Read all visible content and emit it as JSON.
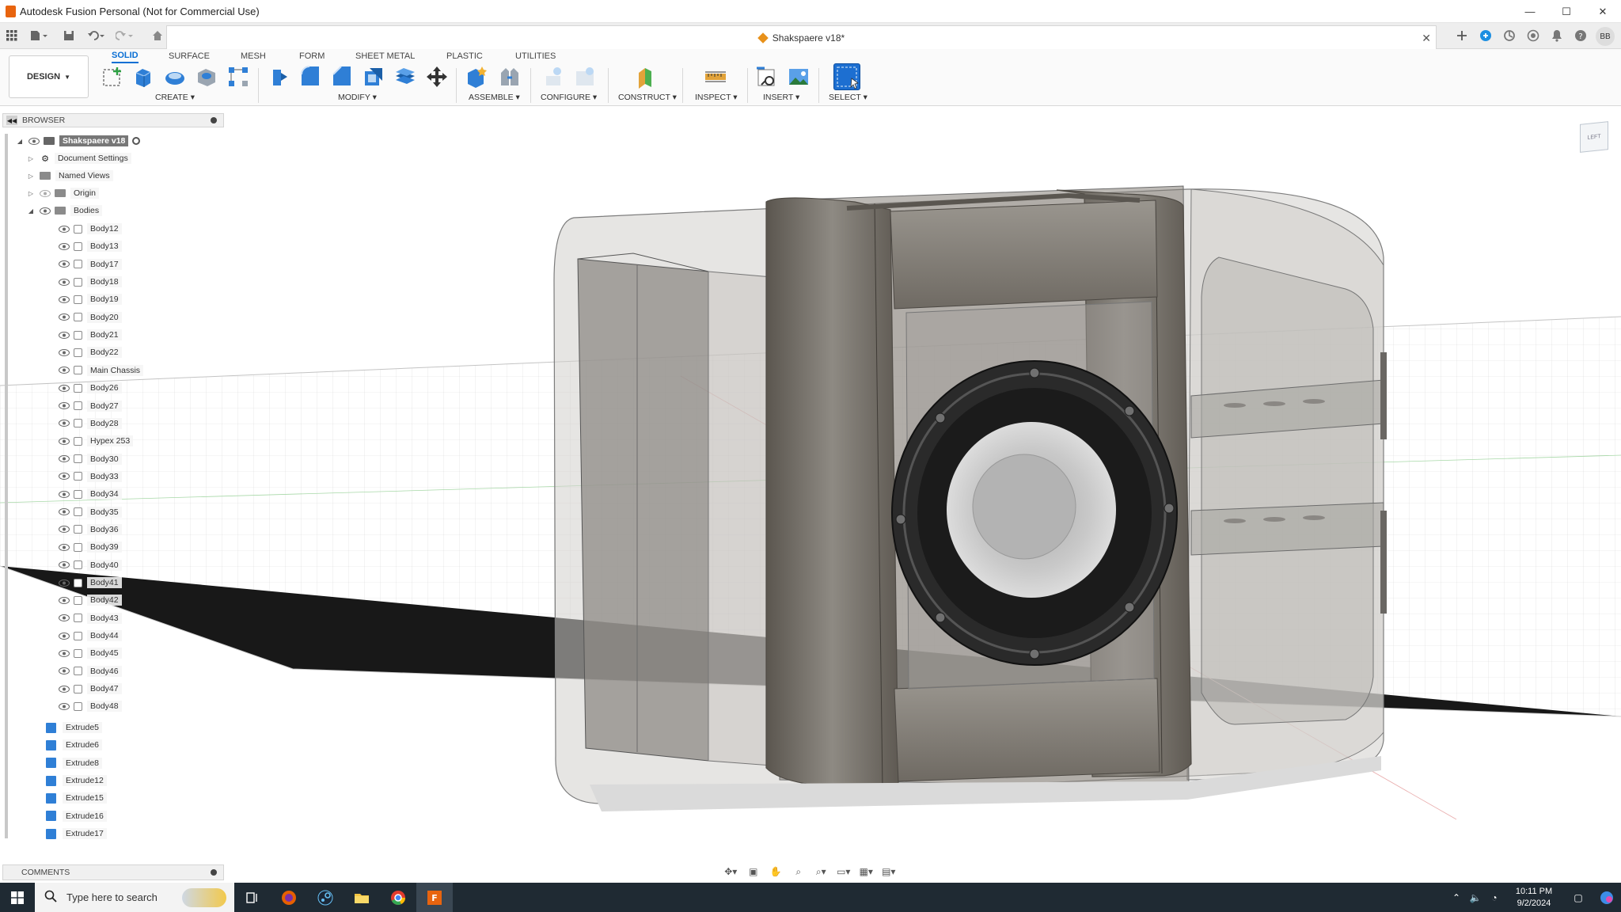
{
  "window": {
    "title": "Autodesk Fusion Personal (Not for Commercial Use)",
    "controls": [
      "—",
      "☐",
      "✕"
    ]
  },
  "doc_tab": {
    "title": "Shakspaere v18*",
    "close": "✕"
  },
  "account": {
    "initials": "BB"
  },
  "ribbon": {
    "workspace": "DESIGN",
    "tabs": [
      "SOLID",
      "SURFACE",
      "MESH",
      "FORM",
      "SHEET METAL",
      "PLASTIC",
      "UTILITIES"
    ],
    "active_tab": "SOLID",
    "groups": [
      "CREATE",
      "MODIFY",
      "ASSEMBLE",
      "CONFIGURE",
      "CONSTRUCT",
      "INSPECT",
      "INSERT",
      "SELECT"
    ]
  },
  "browser": {
    "title": "BROWSER",
    "root": "Shakspaere v18",
    "top_items": [
      "Document Settings",
      "Named Views",
      "Origin",
      "Bodies"
    ],
    "bodies": [
      "Body12",
      "Body13",
      "Body17",
      "Body18",
      "Body19",
      "Body20",
      "Body21",
      "Body22",
      "Main Chassis",
      "Body26",
      "Body27",
      "Body28",
      "Hypex 253",
      "Body30",
      "Body33",
      "Body34",
      "Body35",
      "Body36",
      "Body39",
      "Body40",
      "Body41",
      "Body42",
      "Body43",
      "Body44",
      "Body45",
      "Body46",
      "Body47",
      "Body48"
    ],
    "timeline_items": [
      "Extrude5",
      "Extrude6",
      "Extrude8",
      "Extrude12",
      "Extrude15",
      "Extrude16",
      "Extrude17"
    ]
  },
  "comments": {
    "title": "COMMENTS"
  },
  "viewcube": {
    "label": "LEFT"
  },
  "taskbar": {
    "search_placeholder": "Type here to search",
    "time": "10:11 PM",
    "date": "9/2/2024"
  },
  "colors": {
    "accent": "#0a6fd4",
    "body_gray": "#8c8c8c",
    "timeline_blue": "#2f7fd6",
    "taskbar_bg": "#1f2a33",
    "fusion_orange": "#e8640f"
  }
}
